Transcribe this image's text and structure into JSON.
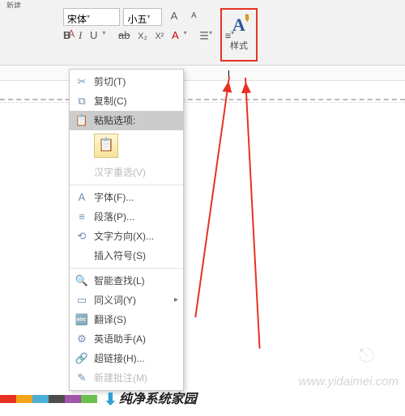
{
  "ribbon": {
    "top_fragment": "新建",
    "font_name": "宋体",
    "font_size": "小五",
    "grow": "A",
    "shrink": "A",
    "clear": "A",
    "styles_icon": "A",
    "styles_label": "样式"
  },
  "format_row": {
    "bold": "B",
    "italic": "I",
    "underline": "U",
    "strike": "ab",
    "sub": "X₂",
    "sup": "X²",
    "fontcolor": "A"
  },
  "context_menu": {
    "cut": "剪切(T)",
    "copy": "复制(C)",
    "paste_header": "粘贴选项:",
    "cjk_reselect": "汉字重选(V)",
    "font": "字体(F)...",
    "paragraph": "段落(P)...",
    "text_direction": "文字方向(X)...",
    "insert_symbol": "插入符号(S)",
    "smart_lookup": "智能查找(L)",
    "synonyms": "同义词(Y)",
    "translate": "翻译(S)",
    "english_assistant": "英语助手(A)",
    "hyperlink": "超链接(H)...",
    "new_comment": "新建批注(M)",
    "paste_icon": "📋"
  },
  "icons": {
    "scissors": "✂",
    "copy": "⧉",
    "clipboard": "📋",
    "font_A": "A",
    "paragraph": "≡",
    "text_dir": "⟲",
    "lookup": "🔍",
    "book": "▭",
    "translate": "🔤",
    "assist": "⚙",
    "link": "🔗",
    "comment": "✎",
    "submenu": "▸"
  },
  "footer": {
    "brand": "纯净系统家园"
  },
  "watermark": "www.yidaimei.com"
}
